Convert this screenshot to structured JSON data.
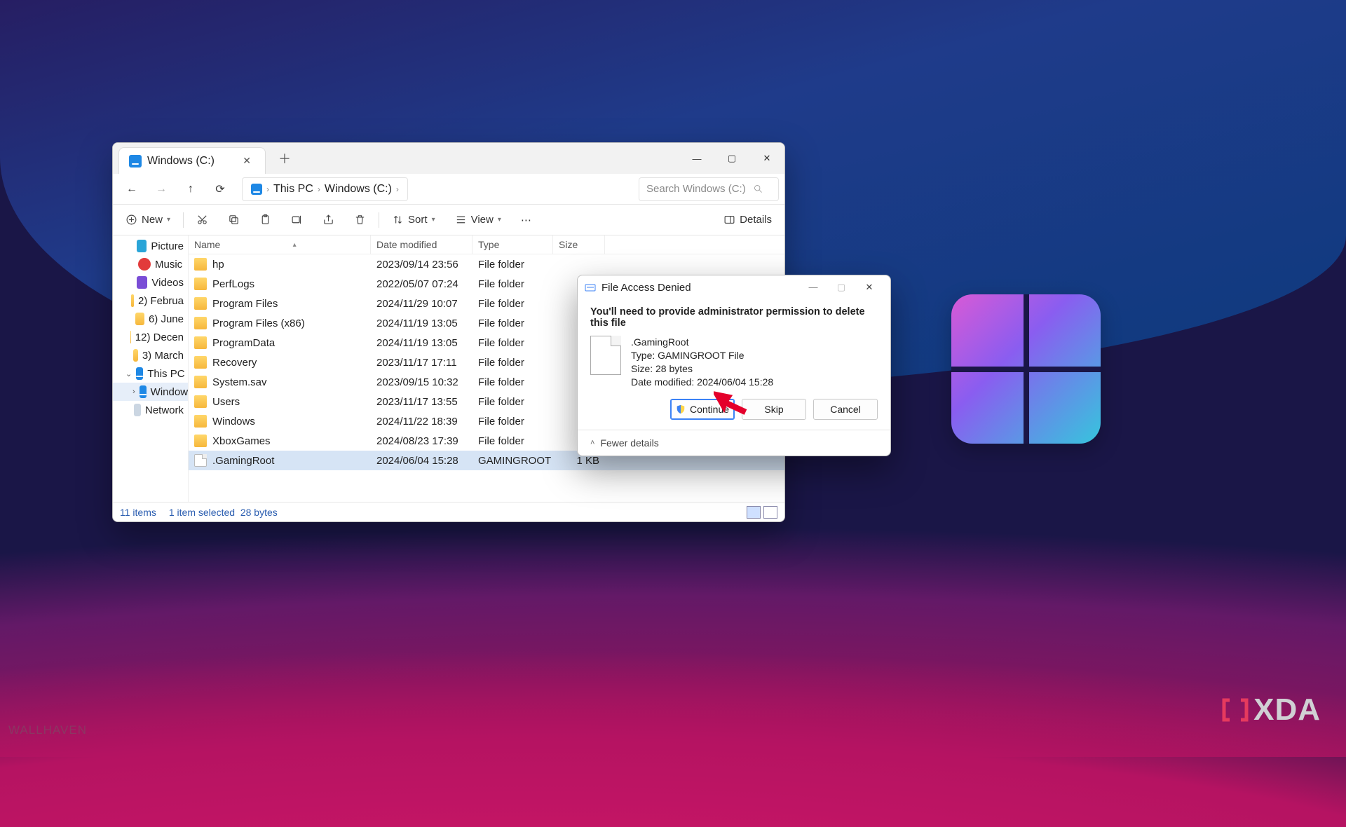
{
  "wallpaper": {
    "credit": "WALLHAVEN"
  },
  "brand": "XDA",
  "explorer": {
    "tab_title": "Windows (C:)",
    "breadcrumb": [
      "This PC",
      "Windows (C:)"
    ],
    "search_placeholder": "Search Windows (C:)",
    "toolbar": {
      "new": "New",
      "sort": "Sort",
      "view": "View",
      "details": "Details"
    },
    "columns": {
      "name": "Name",
      "modified": "Date modified",
      "type": "Type",
      "size": "Size"
    },
    "sidebar": [
      {
        "icon": "pic",
        "label": "Picture"
      },
      {
        "icon": "music",
        "label": "Music"
      },
      {
        "icon": "vid",
        "label": "Videos"
      },
      {
        "icon": "folder",
        "label": "2) Februa"
      },
      {
        "icon": "folder",
        "label": "6) June"
      },
      {
        "icon": "folder",
        "label": "12) Decen"
      },
      {
        "icon": "folder",
        "label": "3) March"
      },
      {
        "icon": "pc",
        "label": "This PC",
        "expanded": true
      },
      {
        "icon": "pc",
        "label": "Window",
        "indent": true,
        "selected": true
      },
      {
        "icon": "net",
        "label": "Network"
      }
    ],
    "rows": [
      {
        "name": "hp",
        "modified": "2023/09/14 23:56",
        "type": "File folder",
        "size": ""
      },
      {
        "name": "PerfLogs",
        "modified": "2022/05/07 07:24",
        "type": "File folder",
        "size": ""
      },
      {
        "name": "Program Files",
        "modified": "2024/11/29 10:07",
        "type": "File folder",
        "size": ""
      },
      {
        "name": "Program Files (x86)",
        "modified": "2024/11/19 13:05",
        "type": "File folder",
        "size": ""
      },
      {
        "name": "ProgramData",
        "modified": "2024/11/19 13:05",
        "type": "File folder",
        "size": ""
      },
      {
        "name": "Recovery",
        "modified": "2023/11/17 17:11",
        "type": "File folder",
        "size": ""
      },
      {
        "name": "System.sav",
        "modified": "2023/09/15 10:32",
        "type": "File folder",
        "size": ""
      },
      {
        "name": "Users",
        "modified": "2023/11/17 13:55",
        "type": "File folder",
        "size": ""
      },
      {
        "name": "Windows",
        "modified": "2024/11/22 18:39",
        "type": "File folder",
        "size": ""
      },
      {
        "name": "XboxGames",
        "modified": "2024/08/23 17:39",
        "type": "File folder",
        "size": ""
      },
      {
        "name": ".GamingRoot",
        "modified": "2024/06/04 15:28",
        "type": "GAMINGROOT File",
        "size": "1 KB",
        "file": true,
        "selected": true
      }
    ],
    "status": {
      "count": "11 items",
      "selection": "1 item selected",
      "bytes": "28 bytes"
    }
  },
  "dialog": {
    "title": "File Access Denied",
    "message": "You'll need to provide administrator permission to delete this file",
    "file_name": ".GamingRoot",
    "file_type": "Type: GAMINGROOT File",
    "file_size": "Size: 28 bytes",
    "file_modified": "Date modified: 2024/06/04 15:28",
    "continue": "Continue",
    "skip": "Skip",
    "cancel": "Cancel",
    "fewer_details": "Fewer details"
  }
}
